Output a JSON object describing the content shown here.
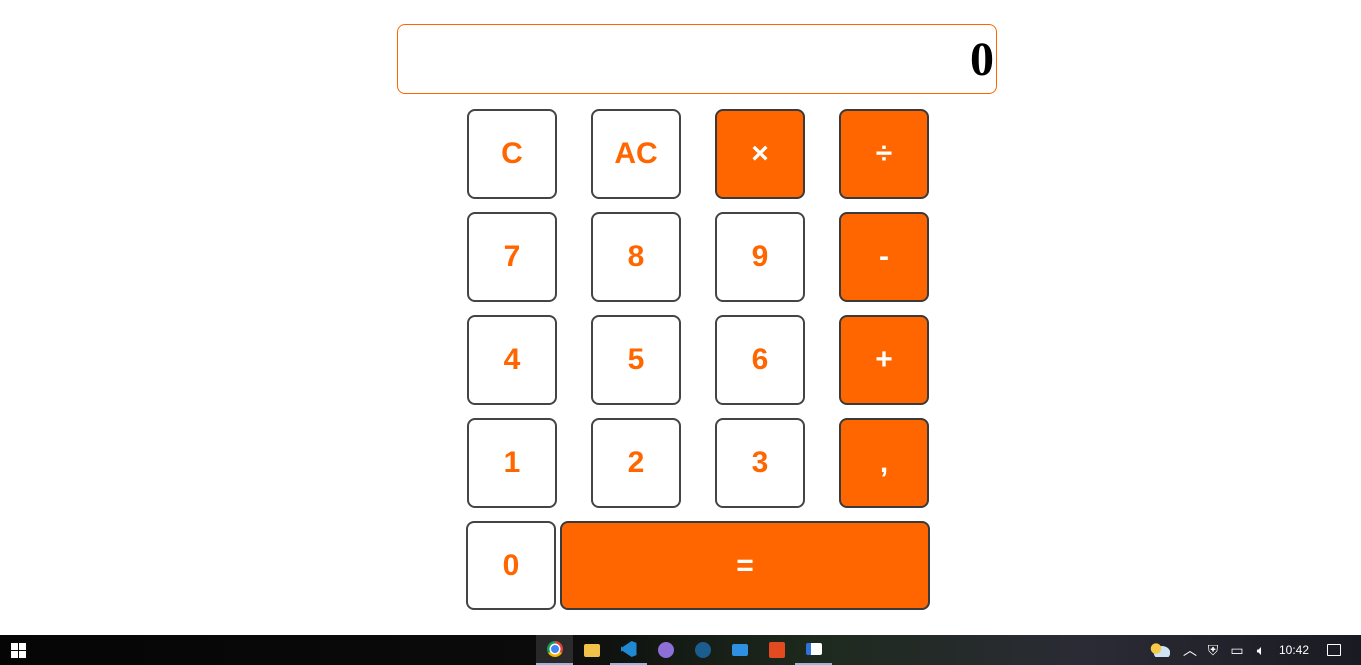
{
  "display": {
    "value": "0"
  },
  "keys": [
    {
      "label": "C",
      "style": "light"
    },
    {
      "label": "AC",
      "style": "light"
    },
    {
      "label": "×",
      "style": "orange"
    },
    {
      "label": "÷",
      "style": "orange"
    },
    {
      "label": "7",
      "style": "light"
    },
    {
      "label": "8",
      "style": "light"
    },
    {
      "label": "9",
      "style": "light"
    },
    {
      "label": "-",
      "style": "orange"
    },
    {
      "label": "4",
      "style": "light"
    },
    {
      "label": "5",
      "style": "light"
    },
    {
      "label": "6",
      "style": "light"
    },
    {
      "label": "+",
      "style": "orange"
    },
    {
      "label": "1",
      "style": "light"
    },
    {
      "label": "2",
      "style": "light"
    },
    {
      "label": "3",
      "style": "light"
    },
    {
      "label": ",",
      "style": "orange"
    },
    {
      "label": "0",
      "style": "light"
    },
    {
      "label": "=",
      "style": "orange"
    }
  ],
  "colors": {
    "accent": "#ff6600",
    "key_border": "#333333",
    "background": "#ffffff"
  },
  "taskbar": {
    "apps": [
      "chrome-icon",
      "file-explorer-icon",
      "vscode-icon",
      "github-desktop-icon",
      "steam-icon",
      "mail-icon",
      "office-icon",
      "news-icon"
    ],
    "clock": "10:42"
  }
}
